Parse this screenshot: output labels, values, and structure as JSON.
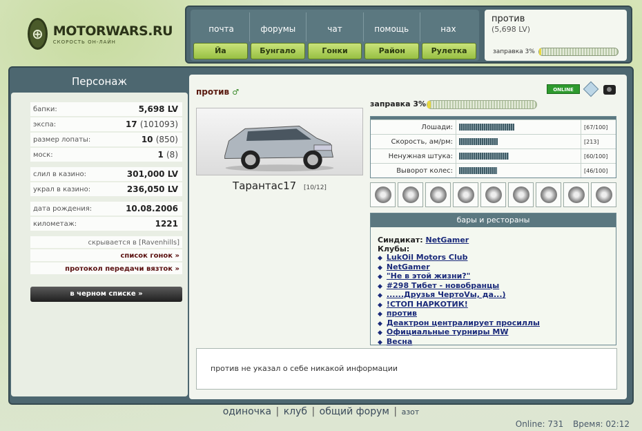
{
  "logo": {
    "title": "MOTORWARS.RU",
    "subtitle": "СКОРОСТЬ ОН-ЛАЙН"
  },
  "nav": {
    "links": [
      "почта",
      "форумы",
      "чат",
      "помощь",
      "нах"
    ],
    "buttons": [
      "Йа",
      "Бунгало",
      "Гонки",
      "Район",
      "Рулетка"
    ]
  },
  "user": {
    "name": "против",
    "money": "(5,698 LV)",
    "fuel_label": "заправка 3%",
    "fuel_percent": 3
  },
  "left": {
    "title": "Персонаж",
    "stats1": [
      {
        "label": "бапки:",
        "value": "5,698 LV",
        "sub": ""
      },
      {
        "label": "экспа:",
        "value": "17",
        "sub": "(101093)"
      },
      {
        "label": "размер лопаты:",
        "value": "10",
        "sub": "(850)"
      },
      {
        "label": "моск:",
        "value": "1",
        "sub": "(8)"
      }
    ],
    "stats2": [
      {
        "label": "слил в казино:",
        "value": "301,000 LV"
      },
      {
        "label": "украл в казино:",
        "value": "236,050 LV"
      }
    ],
    "stats3": [
      {
        "label": "дата рождения:",
        "value": "10.08.2006"
      },
      {
        "label": "километаж:",
        "value": "1221"
      }
    ],
    "hides_in": "скрывается в [Ravenhills]",
    "races_link": "список гонок »",
    "bribe_link": "протокол передачи вязток »",
    "blacklist_button": "в черном списке »"
  },
  "profile": {
    "name": "против",
    "online": "ONLINE",
    "fuel_label": "заправка 3%",
    "fuel_percent": 3,
    "car_name": "Тарантас17",
    "car_count": "[10/12]",
    "stats": [
      {
        "label": "Лошади:",
        "value": "[67/100]",
        "ratio": 0.67
      },
      {
        "label": "Скорость, ам/рм:",
        "value": "[213]",
        "ratio": 0.47
      },
      {
        "label": "Ненужная штука:",
        "value": "[60/100]",
        "ratio": 0.6
      },
      {
        "label": "Выворот колес:",
        "value": "[46/100]",
        "ratio": 0.46
      }
    ],
    "parts": [
      "tire-icon",
      "exhaust-icon",
      "spoiler-icon",
      "brake-disc-icon",
      "suspension-icon",
      "wheel-icon",
      "engine-icon",
      "turbo-icon",
      "nitro-icon"
    ],
    "bars_title": "бары и рестораны",
    "syndicate_label": "Синдикат:",
    "syndicate": "NetGamer",
    "clubs_label": "Клубы:",
    "clubs": [
      "LukOil Motors Club",
      "NetGamer",
      "\"Не в этой жизни?\"",
      "#298 Тибет - новобранцы",
      "......Друзья ЧертоVы, да...)",
      "!СТОП НАРКОТИК!",
      "против",
      "Деактрон централирует просиллы",
      "Официальные турниры MW",
      "Весна"
    ],
    "about": "против не указал о себе никакой информации"
  },
  "footer": {
    "links": [
      "одиночка",
      "клуб",
      "общий форум",
      "азот"
    ],
    "online": "Online: 731",
    "time": "Время: 02:12"
  }
}
